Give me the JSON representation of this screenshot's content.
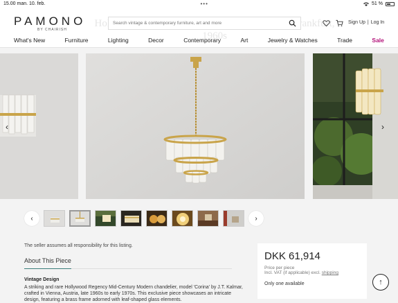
{
  "status": {
    "time": "15.00",
    "date": "man. 10. feb.",
    "dots": "•••",
    "battery": "51 %",
    "battery_level": 0.51
  },
  "header": {
    "logo": "PAMONO",
    "logo_sub": "BY CHAIRISH",
    "ghost_title": "Hollywood Regency Chandelier in Brass Glass Frankfurt, 1960s",
    "search_placeholder": "Search vintage & contemporary furniture, art and more",
    "signup": "Sign Up",
    "separator": "|",
    "login": "Log In"
  },
  "nav": {
    "items": [
      "What's New",
      "Furniture",
      "Lighting",
      "Decor",
      "Contemporary",
      "Art",
      "Jewelry & Watches",
      "Trade"
    ],
    "sale": "Sale",
    "sale_color": "#b3127a"
  },
  "gallery": {
    "prev": "‹",
    "next": "›",
    "thumb_count": 7
  },
  "listing": {
    "disclaimer": "The seller assumes all responsibility for this listing.",
    "about_title": "About This Piece",
    "vintage_label": "Vintage Design",
    "description": "A striking and rare Hollywood Regency Mid-Century Modern chandelier, model 'Corina' by J.T. Kalmar, crafted in Vienna, Austria, late 1960s to early 1970s. This exclusive piece showcases an intricate design, featuring a brass frame adorned with leaf-shaped glass elements."
  },
  "price_card": {
    "price": "DKK 61,914",
    "price_note": "Price per piece",
    "vat_prefix": "Incl. VAT (if applicable) excl.",
    "shipping": "shipping",
    "availability": "Only one available"
  },
  "back_to_top": "↑",
  "accent": "#3a7d7a"
}
